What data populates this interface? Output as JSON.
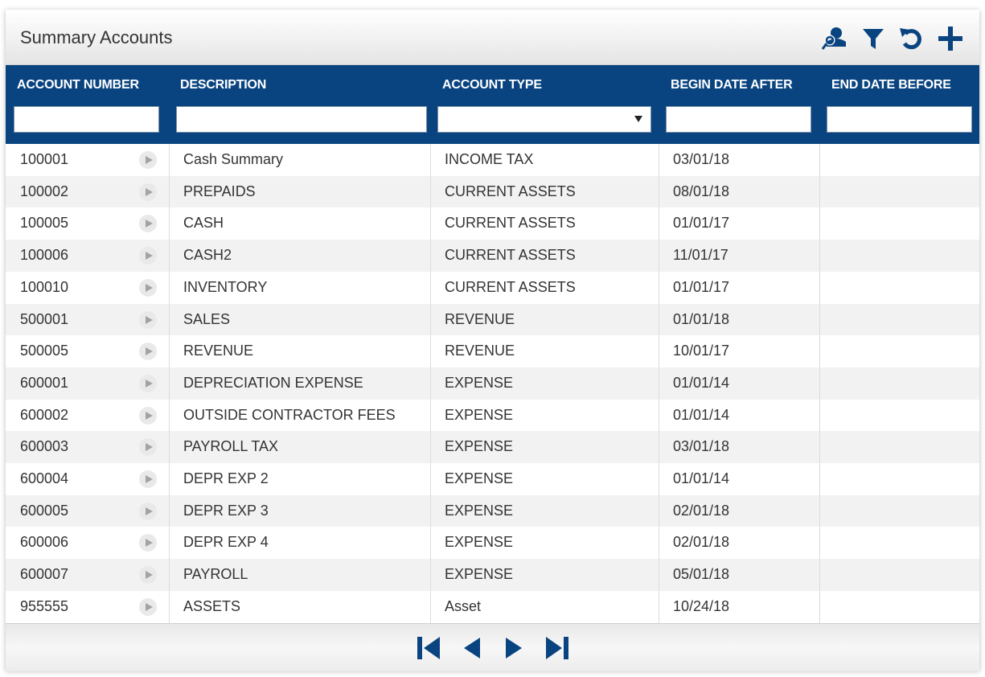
{
  "title": "Summary Accounts",
  "toolbar": {
    "icons": [
      "user-search-icon",
      "filter-icon",
      "refresh-icon",
      "add-icon"
    ],
    "icon_color": "#0a4480"
  },
  "columns": [
    {
      "key": "account_number",
      "label": "ACCOUNT NUMBER"
    },
    {
      "key": "description",
      "label": "DESCRIPTION"
    },
    {
      "key": "account_type",
      "label": "ACCOUNT TYPE"
    },
    {
      "key": "begin_date_after",
      "label": "BEGIN DATE AFTER"
    },
    {
      "key": "end_date_before",
      "label": "END DATE BEFORE"
    }
  ],
  "filters": {
    "account_number": "",
    "description": "",
    "account_type": "",
    "begin_date_after": "",
    "end_date_before": ""
  },
  "rows": [
    {
      "account_number": "100001",
      "description": "Cash Summary",
      "account_type": "INCOME TAX",
      "begin_date_after": "03/01/18",
      "end_date_before": ""
    },
    {
      "account_number": "100002",
      "description": "PREPAIDS",
      "account_type": "CURRENT ASSETS",
      "begin_date_after": "08/01/18",
      "end_date_before": ""
    },
    {
      "account_number": "100005",
      "description": "CASH",
      "account_type": "CURRENT ASSETS",
      "begin_date_after": "01/01/17",
      "end_date_before": ""
    },
    {
      "account_number": "100006",
      "description": "CASH2",
      "account_type": "CURRENT ASSETS",
      "begin_date_after": "11/01/17",
      "end_date_before": ""
    },
    {
      "account_number": "100010",
      "description": "INVENTORY",
      "account_type": "CURRENT ASSETS",
      "begin_date_after": "01/01/17",
      "end_date_before": ""
    },
    {
      "account_number": "500001",
      "description": "SALES",
      "account_type": "REVENUE",
      "begin_date_after": "01/01/18",
      "end_date_before": ""
    },
    {
      "account_number": "500005",
      "description": "REVENUE",
      "account_type": "REVENUE",
      "begin_date_after": "10/01/17",
      "end_date_before": ""
    },
    {
      "account_number": "600001",
      "description": "DEPRECIATION EXPENSE",
      "account_type": "EXPENSE",
      "begin_date_after": "01/01/14",
      "end_date_before": ""
    },
    {
      "account_number": "600002",
      "description": "OUTSIDE CONTRACTOR FEES",
      "account_type": "EXPENSE",
      "begin_date_after": "01/01/14",
      "end_date_before": ""
    },
    {
      "account_number": "600003",
      "description": "PAYROLL TAX",
      "account_type": "EXPENSE",
      "begin_date_after": "03/01/18",
      "end_date_before": ""
    },
    {
      "account_number": "600004",
      "description": "DEPR EXP 2",
      "account_type": "EXPENSE",
      "begin_date_after": "01/01/14",
      "end_date_before": ""
    },
    {
      "account_number": "600005",
      "description": "DEPR EXP 3",
      "account_type": "EXPENSE",
      "begin_date_after": "02/01/18",
      "end_date_before": ""
    },
    {
      "account_number": "600006",
      "description": "DEPR EXP 4",
      "account_type": "EXPENSE",
      "begin_date_after": "02/01/18",
      "end_date_before": ""
    },
    {
      "account_number": "600007",
      "description": "PAYROLL",
      "account_type": "EXPENSE",
      "begin_date_after": "05/01/18",
      "end_date_before": ""
    },
    {
      "account_number": "955555",
      "description": "ASSETS",
      "account_type": "Asset",
      "begin_date_after": "10/24/18",
      "end_date_before": ""
    }
  ],
  "pagination": {
    "icons": [
      "first-page-icon",
      "previous-page-icon",
      "next-page-icon",
      "last-page-icon"
    ]
  }
}
